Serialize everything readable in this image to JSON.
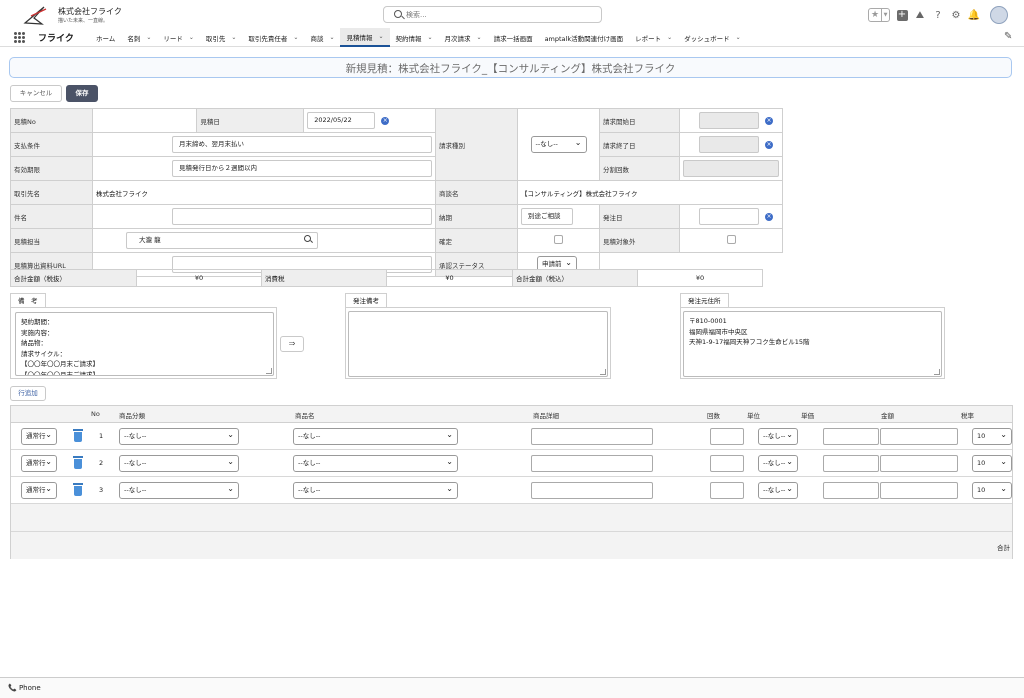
{
  "header": {
    "company": "株式会社フライク",
    "slogan": "描いた未来、一直線。",
    "search_placeholder": "検索..."
  },
  "nav": {
    "app_name": "フライク",
    "items": [
      {
        "label": "ホーム",
        "chevron": false
      },
      {
        "label": "名刺",
        "chevron": true
      },
      {
        "label": "リード",
        "chevron": true
      },
      {
        "label": "取引先",
        "chevron": true
      },
      {
        "label": "取引先責任者",
        "chevron": true
      },
      {
        "label": "商談",
        "chevron": true
      },
      {
        "label": "見積情報",
        "chevron": true,
        "active": true
      },
      {
        "label": "契約情報",
        "chevron": true
      },
      {
        "label": "月次請求",
        "chevron": true
      },
      {
        "label": "請求一括画面",
        "chevron": false
      },
      {
        "label": "amptalk活動関連付け画面",
        "chevron": false
      },
      {
        "label": "レポート",
        "chevron": true
      },
      {
        "label": "ダッシュボード",
        "chevron": true
      }
    ]
  },
  "page": {
    "title": "新規見積：株式会社フライク_【コンサルティング】株式会社フライク",
    "cancel_label": "キャンセル",
    "save_label": "保存"
  },
  "form": {
    "estimate_no_label": "見積No",
    "estimate_date_label": "見積日",
    "estimate_date_value": "2022/05/22",
    "billing_type_label": "請求種別",
    "billing_type_value": "--なし--",
    "billing_start_label": "請求開始日",
    "billing_end_label": "請求終了日",
    "payment_label": "支払条件",
    "payment_value": "月末締め、翌月末払い",
    "validity_label": "有効期限",
    "validity_value": "見積発行日から２週間以内",
    "split_label": "分割回数",
    "client_label": "取引先名",
    "client_value": "株式会社フライク",
    "deal_label": "商談名",
    "deal_value": "【コンサルティング】株式会社フライク",
    "subject_label": "件名",
    "delivery_label": "納期",
    "delivery_value": "別途ご相談",
    "order_date_label": "発注日",
    "owner_label": "見積担当",
    "owner_value": "大瀧 龍",
    "confirm_label": "確定",
    "exclude_label": "見積対象外",
    "url_label": "見積算出資料URL",
    "approval_label": "承認ステータス",
    "approval_value": "申請前"
  },
  "totals": {
    "ex_tax_label": "合計金額（税抜）",
    "ex_tax_value": "¥0",
    "tax_label": "消費税",
    "tax_value": "¥0",
    "in_tax_label": "合計金額（税込）",
    "in_tax_value": "¥0"
  },
  "notes": {
    "remarks_label": "備　考",
    "remarks_text": "契約期間：\n実施内容：\n納品物：\n請求サイクル：\n【〇〇年〇〇月末ご請求】\n【〇〇年〇〇月末ご請求】",
    "arrow_label": "⇒",
    "order_remarks_label": "発注備考",
    "address_label": "発注元住所",
    "address_text": "〒810-0001\n福岡県福岡市中央区\n天神1-9-17福岡天神フコク生命ビル15階"
  },
  "lines": {
    "add_row_label": "行追加",
    "headers": {
      "no": "No",
      "category": "商品分類",
      "product": "商品名",
      "detail": "商品詳細",
      "qty": "回数",
      "unit": "単位",
      "price": "単価",
      "amount": "金額",
      "tax": "税率"
    },
    "rows": [
      {
        "type": "通常行",
        "no": "1",
        "category": "--なし--",
        "product": "--なし--",
        "unit": "--なし--",
        "tax": "10"
      },
      {
        "type": "通常行",
        "no": "2",
        "category": "--なし--",
        "product": "--なし--",
        "unit": "--なし--",
        "tax": "10"
      },
      {
        "type": "通常行",
        "no": "3",
        "category": "--なし--",
        "product": "--なし--",
        "unit": "--なし--",
        "tax": "10"
      }
    ],
    "total_label": "合計"
  },
  "footer": {
    "phone_label": "Phone"
  }
}
